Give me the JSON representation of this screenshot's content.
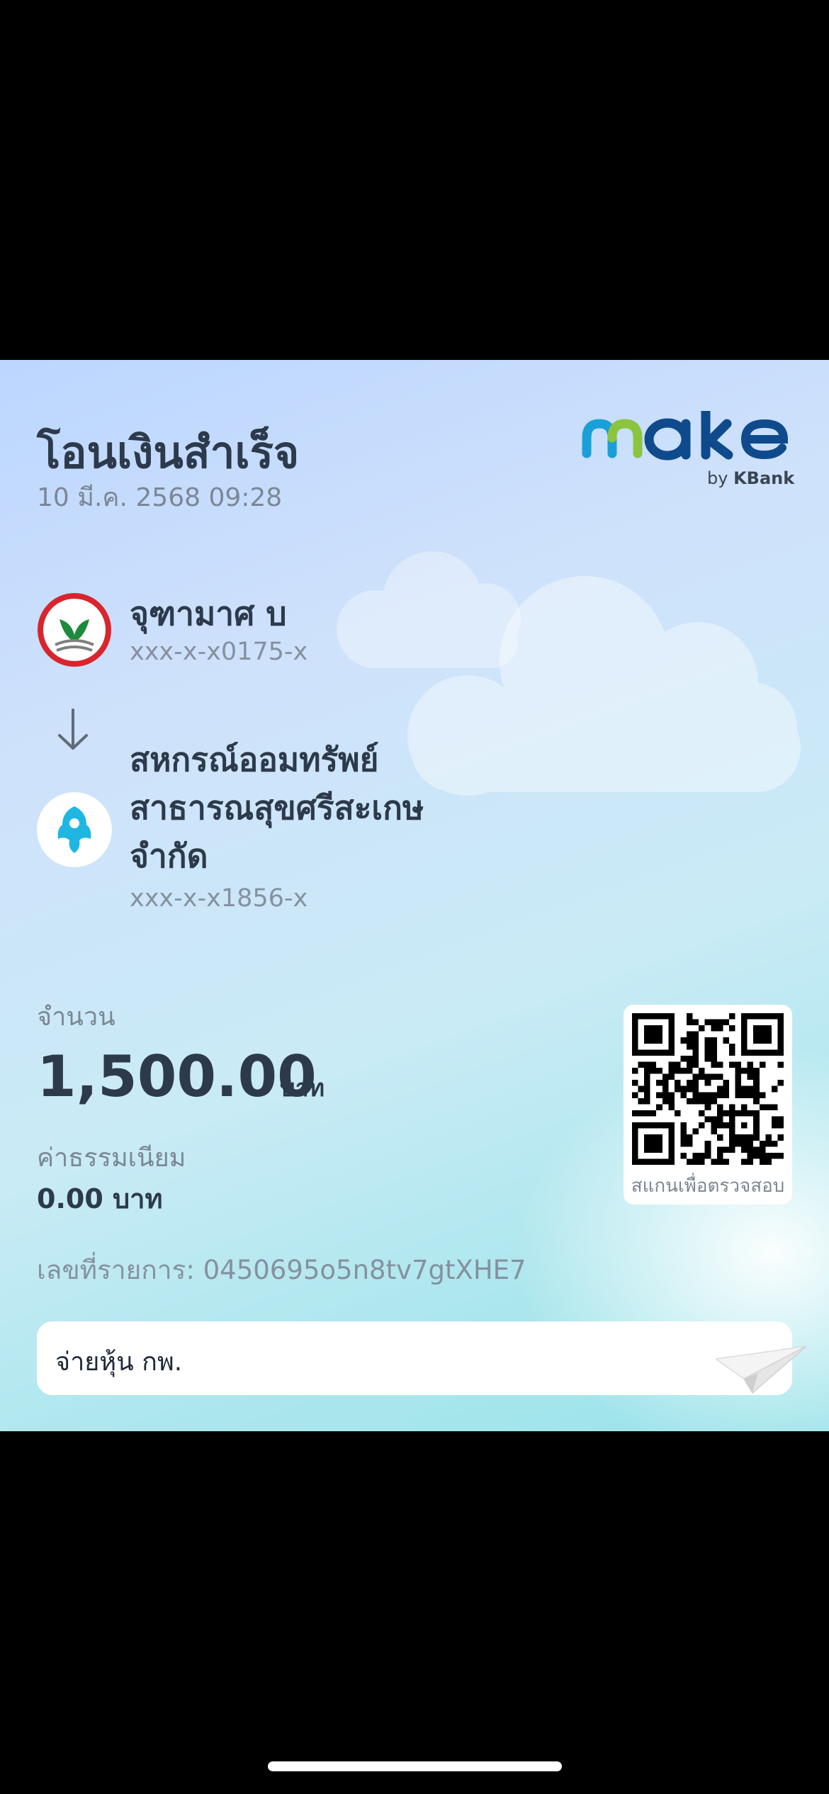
{
  "receipt": {
    "title": "โอนเงินสำเร็จ",
    "datetime": "10 มี.ค. 2568 09:28",
    "brand": {
      "logo_text": "make",
      "by_text": "by",
      "bank_text": "KBank"
    },
    "sender": {
      "name": "จุฑามาศ บ",
      "account": "xxx-x-x0175-x",
      "bank_icon": "kbank-logo-icon"
    },
    "receiver": {
      "name_line1": "สหกรณ์ออมทรัพย์",
      "name_line2": "สาธารณสุขศรีสะเกษ",
      "name_line3": "จำกัด",
      "account": "xxx-x-x1856-x",
      "bank_icon": "ktb-logo-icon"
    },
    "amount_label": "จำนวน",
    "amount": "1,500.00",
    "amount_unit": "บาท",
    "fee_label": "ค่าธรรมเนียม",
    "fee": "0.00 บาท",
    "transaction_id": "เลขที่รายการ: 0450695o5n8tv7gtXHE7",
    "qr_caption": "สแกนเพื่อตรวจสอบ",
    "memo": "จ่ายหุ้น กพ."
  },
  "colors": {
    "kbank_green": "#1e8b3c",
    "kbank_red": "#d9252c",
    "ktb_cyan": "#1fb7e2",
    "brand_blue": "#1aa0d8",
    "brand_green": "#8bc53f",
    "text_dark": "#2d3a4b"
  }
}
